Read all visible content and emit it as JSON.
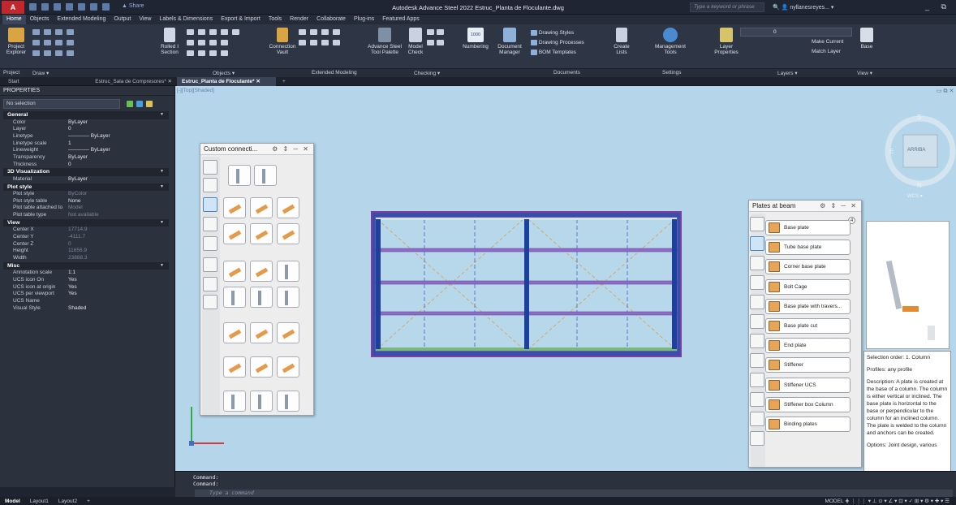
{
  "titlebar": {
    "app_logo": "A",
    "logo_sub": "ASI",
    "share": "Share",
    "title": "Autodesk Advance Steel 2022  Estruc_Planta de Floculante.dwg",
    "search_placeholder": "Type a keyword or phrase",
    "user": "nyllanesreyes...",
    "window_controls": "_ ⧉"
  },
  "menu": [
    "Home",
    "Objects",
    "Extended Modeling",
    "Output",
    "View",
    "Labels & Dimensions",
    "Export & Import",
    "Tools",
    "Render",
    "Collaborate",
    "Plug-ins",
    "Featured Apps"
  ],
  "ribbon": {
    "buttons": [
      {
        "label": "Project Explorer",
        "icon": "project-explorer-icon"
      },
      {
        "label": "Rolled I Section",
        "icon": "rolled-section-icon"
      },
      {
        "label": "Connection Vault",
        "icon": "connection-vault-icon"
      },
      {
        "label": "Advance Steel Tool Palette",
        "icon": "tool-palette-icon"
      },
      {
        "label": "Model Check",
        "icon": "model-check-icon"
      },
      {
        "label": "Numbering",
        "icon": "numbering-icon"
      },
      {
        "label": "Document Manager",
        "icon": "document-manager-icon"
      },
      {
        "label": "Drawing Styles",
        "icon": "drawing-styles-icon"
      },
      {
        "label": "Drawing Processes",
        "icon": "drawing-processes-icon"
      },
      {
        "label": "BOM Templates",
        "icon": "bom-templates-icon"
      },
      {
        "label": "Create Lists",
        "icon": "create-lists-icon"
      },
      {
        "label": "Management Tools",
        "icon": "management-tools-icon"
      },
      {
        "label": "Layer Properties",
        "icon": "layer-properties-icon"
      },
      {
        "label": "Make Current",
        "icon": "make-current-icon"
      },
      {
        "label": "Match Layer",
        "icon": "match-layer-icon"
      },
      {
        "label": "Base",
        "icon": "base-icon"
      }
    ],
    "layer_value": "0",
    "numbering_badge": "1000",
    "panels": [
      "Project",
      "Draw ▾",
      "Objects ▾",
      "Extended Modeling",
      "Checking ▾",
      "Documents",
      "Settings",
      "Layers ▾",
      "View ▾"
    ]
  },
  "tabs": [
    "Start",
    "Estruc_Sala de Compresores*",
    "Estruc_Planta de Floculante*"
  ],
  "tab_close": "✕",
  "tab_add": "+",
  "properties": {
    "title": "PROPERTIES",
    "selection": "No selection",
    "sections": [
      {
        "name": "General",
        "rows": [
          [
            "Color",
            "ByLayer"
          ],
          [
            "Layer",
            "0"
          ],
          [
            "Linetype",
            "———— ByLayer"
          ],
          [
            "Linetype scale",
            "1"
          ],
          [
            "Lineweight",
            "———— ByLayer"
          ],
          [
            "Transparency",
            "ByLayer"
          ],
          [
            "Thickness",
            "0"
          ]
        ]
      },
      {
        "name": "3D Visualization",
        "rows": [
          [
            "Material",
            "ByLayer"
          ]
        ]
      },
      {
        "name": "Plot style",
        "rows": [
          [
            "Plot style",
            "ByColor"
          ],
          [
            "Plot style table",
            "None"
          ],
          [
            "Plot table attached to",
            "Model"
          ],
          [
            "Plot table type",
            "Not available"
          ]
        ]
      },
      {
        "name": "View",
        "rows": [
          [
            "Center X",
            "17714.9"
          ],
          [
            "Center Y",
            "-4111.7"
          ],
          [
            "Center Z",
            "0"
          ],
          [
            "Height",
            "11656.9"
          ],
          [
            "Width",
            "23888.3"
          ]
        ]
      },
      {
        "name": "Misc",
        "rows": [
          [
            "Annotation scale",
            "1:1"
          ],
          [
            "UCS icon On",
            "Yes"
          ],
          [
            "UCS icon at origin",
            "Yes"
          ],
          [
            "UCS per viewport",
            "Yes"
          ],
          [
            "UCS Name",
            ""
          ],
          [
            "Visual Style",
            "Shaded"
          ]
        ]
      }
    ]
  },
  "viewport": {
    "label": "[-][Top][Shaded]",
    "controls": "▭ ⧉ ✕",
    "viewcube": {
      "top": "S",
      "east": "ARRIBA",
      "west": "E",
      "bottom": "N",
      "wcs": "WCS"
    }
  },
  "custom_palette": {
    "title": "Custom connecti...",
    "controls": "⚙ ⇕ ─ ✕"
  },
  "plates_palette": {
    "title": "Plates at beam",
    "controls": "⚙ ⇕ ─ ✕",
    "badge": "4",
    "buttons": [
      "Base plate",
      "Tube base plate",
      "Corner base plate",
      "Bolt Cage",
      "Base plate with travers...",
      "Base plate cut",
      "End plate",
      "Stiffener",
      "Stiffener UCS",
      "Stiffener box Column",
      "Binding plates"
    ]
  },
  "description": {
    "selection_order": "Selection order: 1. Column",
    "profiles": "Profiles: any profile",
    "text": "Description: A plate is created at the base of a column. The column is either vertical or inclined. The base plate is horizontal to the base or perpendicular to the column for an inclined column. The plate is welded to the column and anchors can be created.",
    "options": "Options: Joint design, various"
  },
  "command": {
    "line1": "Command:",
    "line2": "Command:",
    "placeholder": "Type a command"
  },
  "status": {
    "tabs": [
      "Model",
      "Layout1",
      "Layout2",
      "+"
    ],
    "right": "MODEL  ⋕ ⋮⋮⋮ ▾ ⊥ ⊙ ▾ ∠ ▾ ⊡ ▾ ✓ ⊞ ▾ ⚙ ▾ ✚ ▾ ☰"
  },
  "colors": {
    "accent": "#c1272d",
    "viewport_bg": "#b5d6ea",
    "beam": "#3a49a8",
    "plate": "#e59a4a"
  }
}
